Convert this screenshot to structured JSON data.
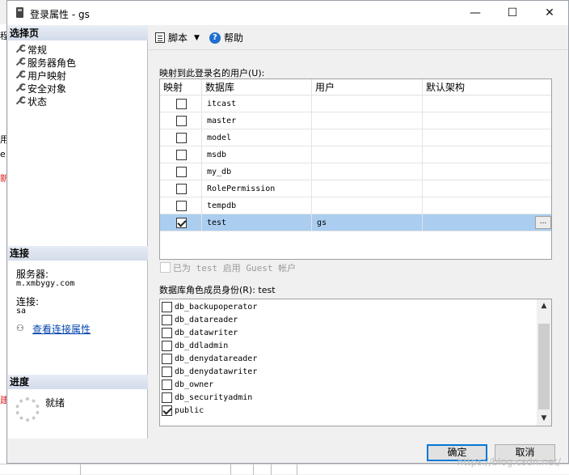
{
  "window": {
    "title": "登录属性 - gs",
    "minimize": "—",
    "maximize": "☐",
    "close": "✕"
  },
  "background_fragments": [
    "程",
    "用",
    "e",
    "新",
    "建"
  ],
  "left_pane": {
    "select_page_header": "选择页",
    "nav_items": [
      "常规",
      "服务器角色",
      "用户映射",
      "安全对象",
      "状态"
    ],
    "connection_header": "连接",
    "server_label": "服务器:",
    "server_value": "m.xmbygy.com",
    "connection_label": "连接:",
    "connection_value": "sa",
    "view_connection_link": "查看连接属性",
    "progress_header": "进度",
    "progress_status": "就绪"
  },
  "toolbar": {
    "script_label": "脚本",
    "help_label": "帮助"
  },
  "mapping": {
    "label": "映射到此登录名的用户(U):",
    "columns": [
      "映射",
      "数据库",
      "用户",
      "默认架构"
    ],
    "rows": [
      {
        "map": false,
        "db": "itcast",
        "user": "",
        "schema": ""
      },
      {
        "map": false,
        "db": "master",
        "user": "",
        "schema": ""
      },
      {
        "map": false,
        "db": "model",
        "user": "",
        "schema": ""
      },
      {
        "map": false,
        "db": "msdb",
        "user": "",
        "schema": ""
      },
      {
        "map": false,
        "db": "my_db",
        "user": "",
        "schema": ""
      },
      {
        "map": false,
        "db": "RolePermission",
        "user": "",
        "schema": ""
      },
      {
        "map": false,
        "db": "tempdb",
        "user": "",
        "schema": ""
      },
      {
        "map": true,
        "db": "test",
        "user": "gs",
        "schema": "",
        "selected": true
      }
    ],
    "ellipsis": "...",
    "guest_label": "已为 test 启用 Guest 帐户"
  },
  "roles": {
    "label": "数据库角色成员身份(R): test",
    "items": [
      {
        "name": "db_backupoperator",
        "checked": false
      },
      {
        "name": "db_datareader",
        "checked": false
      },
      {
        "name": "db_datawriter",
        "checked": false
      },
      {
        "name": "db_ddladmin",
        "checked": false
      },
      {
        "name": "db_denydatareader",
        "checked": false
      },
      {
        "name": "db_denydatawriter",
        "checked": false
      },
      {
        "name": "db_owner",
        "checked": false
      },
      {
        "name": "db_securityadmin",
        "checked": false
      },
      {
        "name": "public",
        "checked": true
      }
    ]
  },
  "buttons": {
    "ok": "确定",
    "cancel": "取消"
  },
  "watermark": "https://blog.csdn.net/"
}
